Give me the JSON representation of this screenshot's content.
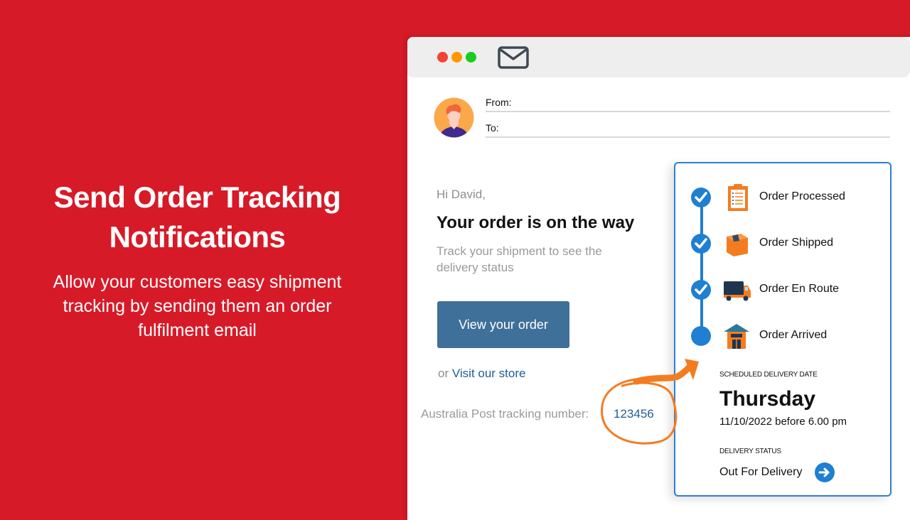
{
  "hero": {
    "title_line1": "Send Order Tracking",
    "title_line2": "Notifications",
    "subtitle": "Allow your customers easy shipment tracking by sending them an order fulfilment email"
  },
  "email": {
    "window_icons": [
      "close-dot-red",
      "minimize-dot-orange",
      "maximize-dot-green",
      "mail-icon"
    ],
    "from_label": "From:",
    "to_label": "To:",
    "greeting": "Hi David,",
    "headline": "Your order is on the way",
    "subline": "Track your shipment to see the delivery status",
    "view_button": "View your order",
    "or_text": "or",
    "visit_link": "Visit our store",
    "tracking_label": "Australia Post tracking number:",
    "tracking_number": "123456"
  },
  "tracker": {
    "steps": [
      {
        "label": "Order Processed",
        "icon": "clipboard-icon",
        "completed": true
      },
      {
        "label": "Order Shipped",
        "icon": "box-icon",
        "completed": true
      },
      {
        "label": "Order En Route",
        "icon": "truck-icon",
        "completed": true
      },
      {
        "label": "Order Arrived",
        "icon": "house-icon",
        "completed": false
      }
    ],
    "scheduled_label": "SCHEDULED DELIVERY DATE",
    "day": "Thursday",
    "date": "11/10/2022 before 6.00 pm",
    "status_label": "DELIVERY STATUS",
    "status": "Out For Delivery"
  },
  "colors": {
    "background": "#d71a28",
    "accent_blue": "#1f7fd0",
    "button_blue": "#3f7099",
    "annotation_orange": "#f47c20"
  }
}
